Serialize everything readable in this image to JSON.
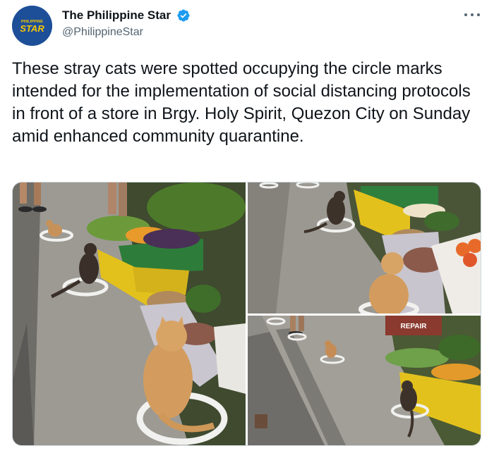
{
  "account": {
    "display_name": "The Philippine Star",
    "handle": "@PhilippineStar",
    "verified": true,
    "avatar_logo_top": "PHILIPPINE",
    "avatar_logo_bottom": "STAR",
    "brand_color": "#1d4f98",
    "logo_color": "#f7c600"
  },
  "header": {
    "more_icon": "more-horizontal-icon"
  },
  "tweet": {
    "text": "These stray cats were spotted occupying the circle marks intended for the implementation of social distancing protocols in front of a store in Brgy. Holy Spirit, Quezon City on Sunday amid enhanced community quarantine."
  },
  "media": {
    "photos": [
      {
        "name": "photo-cats-circles-wide"
      },
      {
        "name": "photo-cat-circle-store"
      },
      {
        "name": "photo-cats-street-circles"
      }
    ],
    "signs": {
      "store_sign": "REPAIR"
    }
  },
  "colors": {
    "verified_blue": "#1d9bf0",
    "text": "#0f1419",
    "secondary_text": "#536471"
  }
}
